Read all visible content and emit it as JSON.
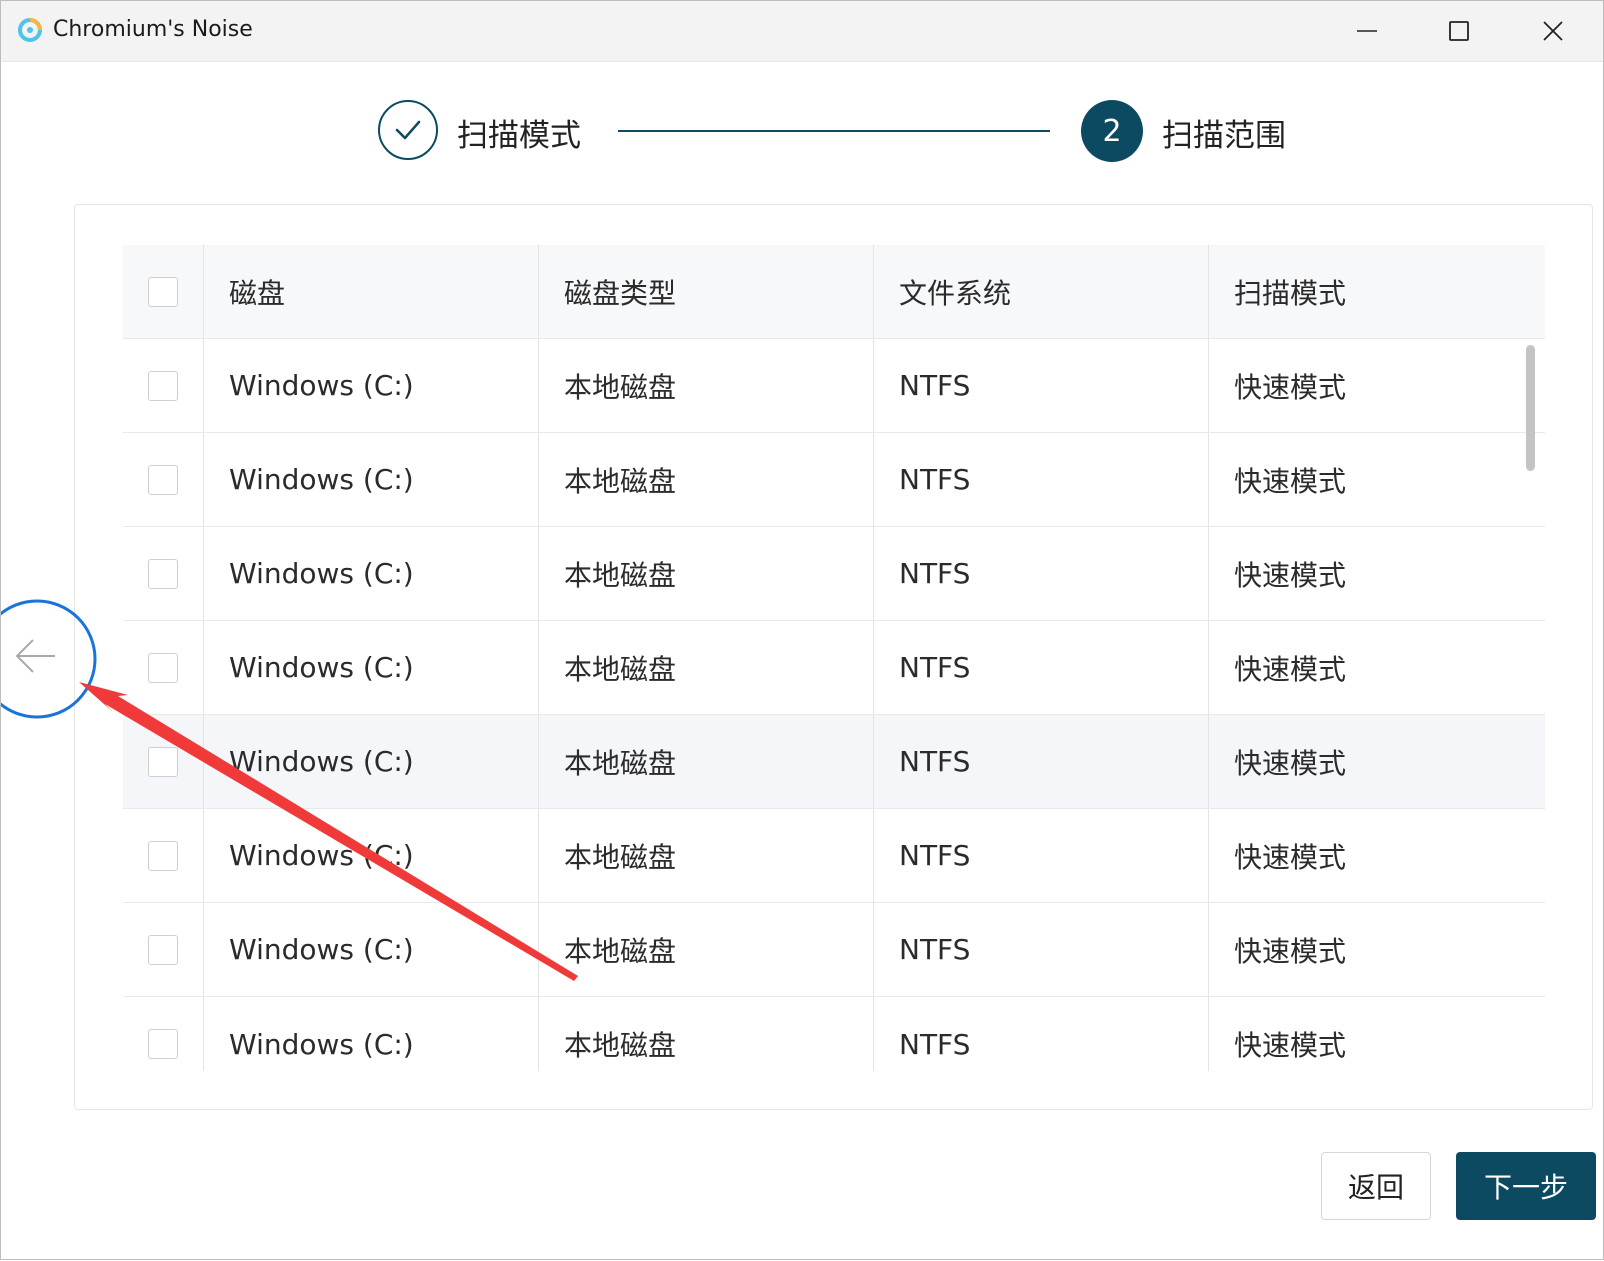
{
  "window": {
    "title": "Chromium's Noise",
    "controls": {
      "minimize": "minimize-icon",
      "maximize": "maximize-icon",
      "close": "close-icon"
    }
  },
  "stepper": {
    "steps": [
      {
        "label": "扫描模式",
        "status": "done",
        "icon": "check-icon"
      },
      {
        "number": "2",
        "label": "扫描范围",
        "status": "active"
      }
    ]
  },
  "table": {
    "columns": [
      "磁盘",
      "磁盘类型",
      "文件系统",
      "扫描模式"
    ],
    "rows": [
      {
        "disk": "Windows (C:)",
        "type": "本地磁盘",
        "fs": "NTFS",
        "mode": "快速模式"
      },
      {
        "disk": "Windows (C:)",
        "type": "本地磁盘",
        "fs": "NTFS",
        "mode": "快速模式"
      },
      {
        "disk": "Windows (C:)",
        "type": "本地磁盘",
        "fs": "NTFS",
        "mode": "快速模式"
      },
      {
        "disk": "Windows (C:)",
        "type": "本地磁盘",
        "fs": "NTFS",
        "mode": "快速模式"
      },
      {
        "disk": "Windows (C:)",
        "type": "本地磁盘",
        "fs": "NTFS",
        "mode": "快速模式"
      },
      {
        "disk": "Windows (C:)",
        "type": "本地磁盘",
        "fs": "NTFS",
        "mode": "快速模式"
      },
      {
        "disk": "Windows (C:)",
        "type": "本地磁盘",
        "fs": "NTFS",
        "mode": "快速模式"
      },
      {
        "disk": "Windows (C:)",
        "type": "本地磁盘",
        "fs": "NTFS",
        "mode": "快速模式"
      }
    ]
  },
  "footer": {
    "back_label": "返回",
    "next_label": "下一步"
  },
  "colors": {
    "primary": "#0c4a62",
    "annotation_circle": "#1a73d8",
    "annotation_arrow": "#f03a3a"
  }
}
